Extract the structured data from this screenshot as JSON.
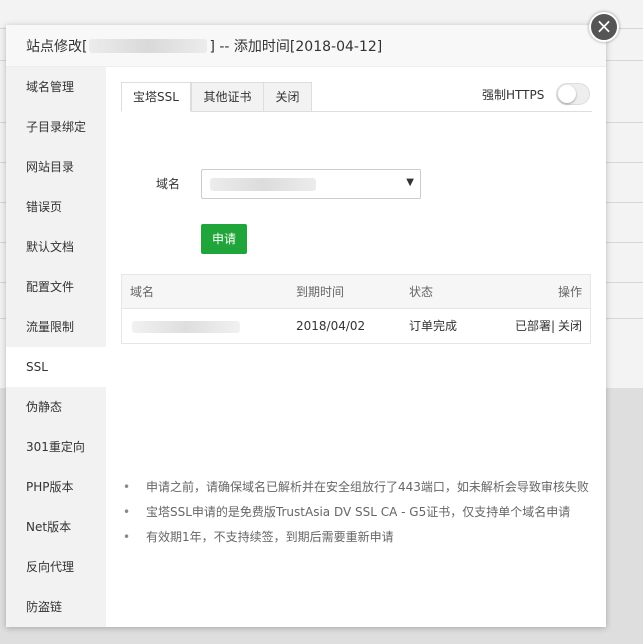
{
  "dialog": {
    "title_prefix": "站点修改[",
    "title_suffix": "] -- 添加时间[2018-04-12]",
    "close_symbol": "×"
  },
  "sidebar": {
    "items": [
      {
        "label": "域名管理"
      },
      {
        "label": "子目录绑定"
      },
      {
        "label": "网站目录"
      },
      {
        "label": "错误页"
      },
      {
        "label": "默认文档"
      },
      {
        "label": "配置文件"
      },
      {
        "label": "流量限制"
      },
      {
        "label": "SSL"
      },
      {
        "label": "伪静态"
      },
      {
        "label": "301重定向"
      },
      {
        "label": "PHP版本"
      },
      {
        "label": "Net版本"
      },
      {
        "label": "反向代理"
      },
      {
        "label": "防盗链"
      }
    ],
    "active_index": 7
  },
  "tabs": [
    {
      "label": "宝塔SSL"
    },
    {
      "label": "其他证书"
    },
    {
      "label": "关闭"
    }
  ],
  "force_https": {
    "label": "强制HTTPS",
    "enabled": false
  },
  "form": {
    "domain_label": "域名",
    "select_arrow": "▼",
    "apply_label": "申请"
  },
  "table": {
    "headers": [
      "域名",
      "到期时间",
      "状态",
      "操作"
    ],
    "rows": [
      {
        "expiry": "2018/04/02",
        "status": "订单完成",
        "deployed": "已部署|",
        "action": "关闭"
      }
    ]
  },
  "notes": [
    "申请之前，请确保域名已解析并在安全组放行了443端口，如未解析会导致审核失败",
    "宝塔SSL申请的是免费版TrustAsia DV SSL CA - G5证书，仅支持单个域名申请",
    "有效期1年，不支持续签，到期后需要重新申请"
  ],
  "colors": {
    "accent_green": "#20a53a",
    "sidebar_bg": "#f2f2f2"
  }
}
